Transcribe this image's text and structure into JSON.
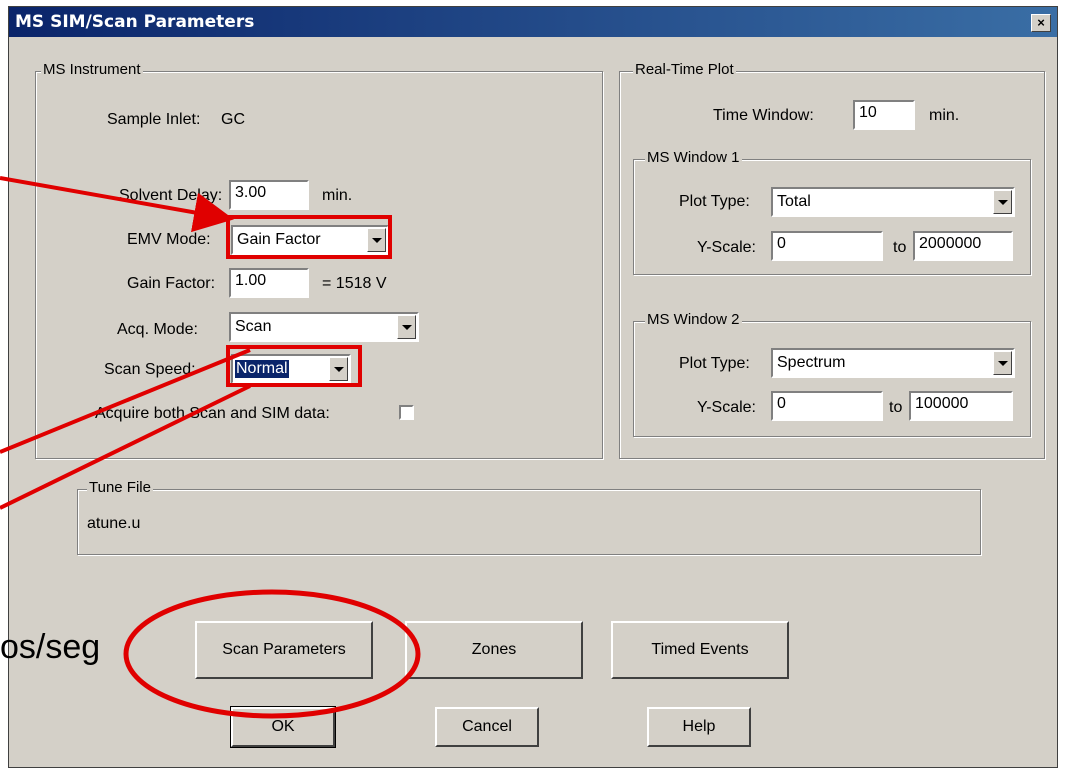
{
  "window": {
    "title": "MS SIM/Scan Parameters",
    "close_symbol": "×"
  },
  "ms_instrument": {
    "legend": "MS Instrument",
    "sample_inlet_label": "Sample Inlet:",
    "sample_inlet_value": "GC",
    "solvent_delay_label": "Solvent Delay:",
    "solvent_delay_value": "3.00",
    "solvent_delay_unit": "min.",
    "emv_mode_label": "EMV Mode:",
    "emv_mode_value": "Gain Factor",
    "gain_factor_label": "Gain Factor:",
    "gain_factor_value": "1.00",
    "gain_factor_result": "= 1518 V",
    "acq_mode_label": "Acq. Mode:",
    "acq_mode_value": "Scan",
    "scan_speed_label": "Scan Speed:",
    "scan_speed_value": "Normal",
    "acquire_both_label": "Acquire both Scan and SIM data:"
  },
  "real_time_plot": {
    "legend": "Real-Time Plot",
    "time_window_label": "Time Window:",
    "time_window_value": "10",
    "time_window_unit": "min.",
    "ms_window_1": {
      "legend": "MS Window 1",
      "plot_type_label": "Plot Type:",
      "plot_type_value": "Total",
      "y_scale_label": "Y-Scale:",
      "y_min": "0",
      "to_label": "to",
      "y_max": "2000000"
    },
    "ms_window_2": {
      "legend": "MS Window 2",
      "plot_type_label": "Plot Type:",
      "plot_type_value": "Spectrum",
      "y_scale_label": "Y-Scale:",
      "y_min": "0",
      "to_label": "to",
      "y_max": "100000"
    }
  },
  "tune_file": {
    "legend": "Tune File",
    "value": "atune.u"
  },
  "buttons": {
    "scan_parameters": "Scan Parameters",
    "zones": "Zones",
    "timed_events": "Timed Events",
    "ok": "OK",
    "cancel": "Cancel",
    "help": "Help"
  },
  "overlay": {
    "partial_text": "os/seg",
    "annotation_color": "#e00000"
  }
}
